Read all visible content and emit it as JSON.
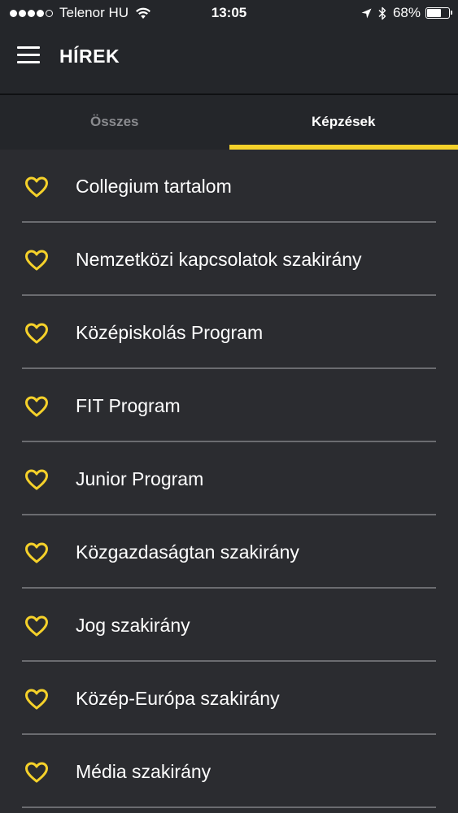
{
  "status_bar": {
    "carrier": "Telenor HU",
    "time": "13:05",
    "battery_percent_text": "68%",
    "battery_level": 0.68,
    "signal_bars_filled": 4,
    "signal_bars_total": 5,
    "icons": [
      "signal-dots",
      "wifi-icon",
      "location-arrow-icon",
      "bluetooth-icon",
      "battery-icon"
    ]
  },
  "header": {
    "title": "HÍREK",
    "menu_icon": "hamburger-menu-icon"
  },
  "tabs": [
    {
      "label": "Összes",
      "active": false
    },
    {
      "label": "Képzések",
      "active": true
    }
  ],
  "colors": {
    "accent": "#f5d12a",
    "background": "#2b2c30",
    "header_background": "#24262a",
    "inactive_tab_text": "#8a8b8f",
    "divider": "#6b6c70"
  },
  "list": {
    "item_icon": "heart-outline-icon",
    "items": [
      {
        "label": "Collegium tartalom"
      },
      {
        "label": "Nemzetközi kapcsolatok szakirány"
      },
      {
        "label": "Középiskolás Program"
      },
      {
        "label": "FIT Program"
      },
      {
        "label": "Junior Program"
      },
      {
        "label": "Közgazdaságtan szakirány"
      },
      {
        "label": "Jog szakirány"
      },
      {
        "label": "Közép-Európa szakirány"
      },
      {
        "label": "Média szakirány"
      }
    ]
  }
}
